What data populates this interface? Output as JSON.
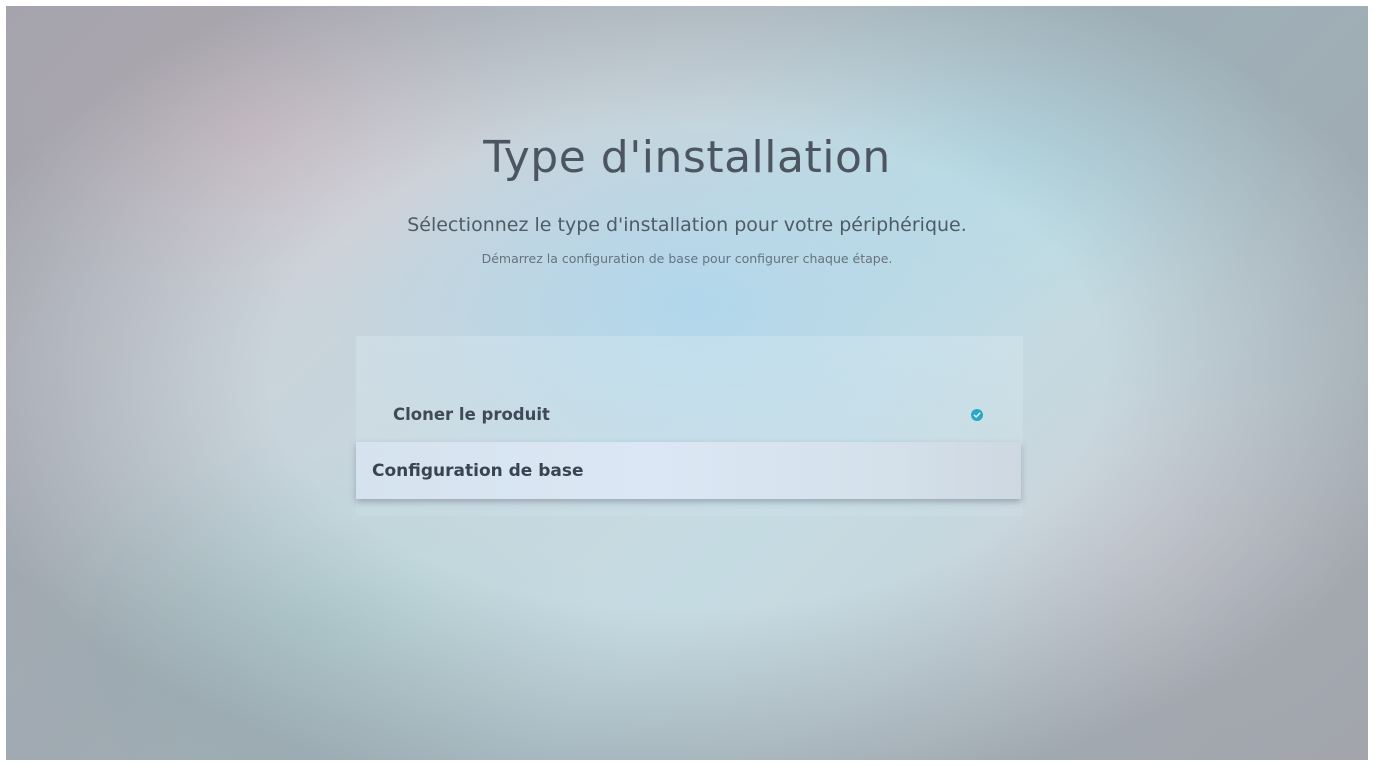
{
  "screen": {
    "title": "Type d'installation",
    "subtitle": "Sélectionnez le type d'installation pour votre périphérique.",
    "hint": "Démarrez la configuration de base pour configurer chaque étape."
  },
  "options": [
    {
      "label": "Cloner le produit",
      "selected": true,
      "indicator_icon": "checkmark-circle-icon"
    },
    {
      "label": "Configuration de base",
      "focused": true
    }
  ],
  "colors": {
    "accent": "#28a7c9",
    "text_primary": "#4b5661",
    "focus_background": "#d8e5f1"
  }
}
